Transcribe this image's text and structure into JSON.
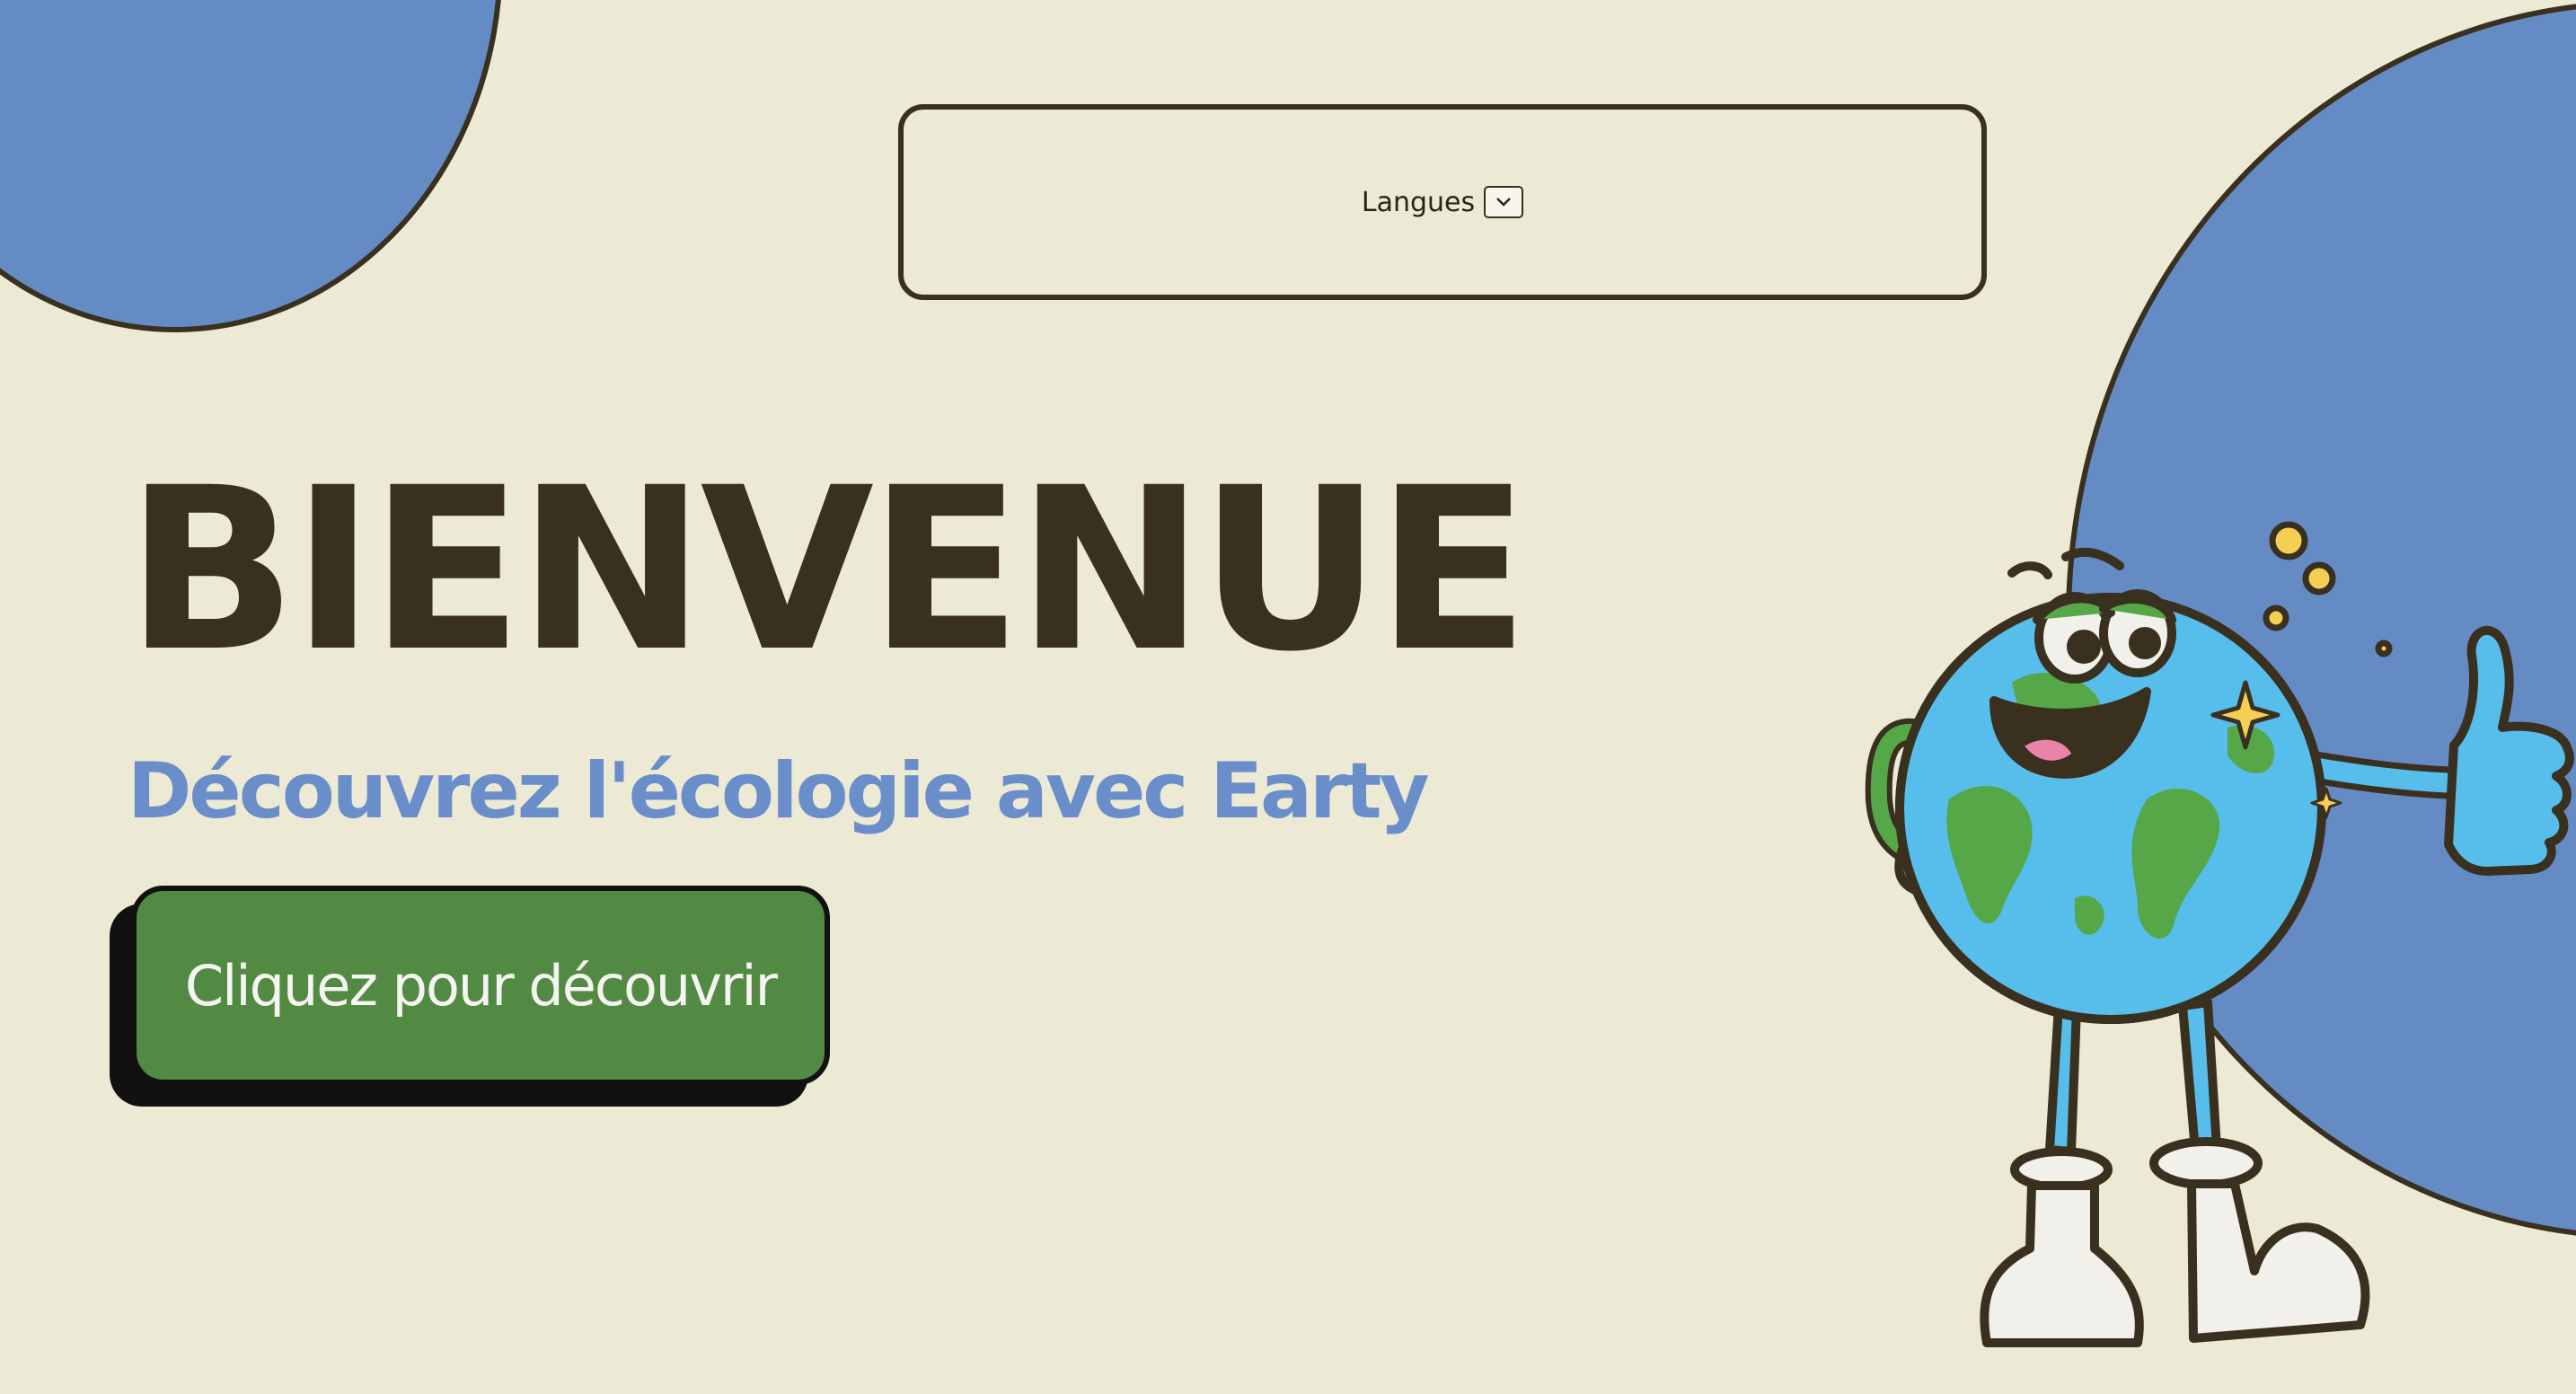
{
  "language_selector": {
    "label": "Langues"
  },
  "hero": {
    "title": "BIENVENUE",
    "subtitle": "Découvrez l'écologie avec Earty",
    "cta_label": "Cliquez pour découvrir"
  },
  "colors": {
    "background": "#ECE9D4",
    "blue_blob": "#658BC5",
    "title": "#3A301F",
    "subtitle": "#6A8EC9",
    "cta": "#528A43"
  },
  "icons": {
    "dropdown": "chevron-down-icon",
    "mascot": "earth-globe-mascot-icon"
  }
}
